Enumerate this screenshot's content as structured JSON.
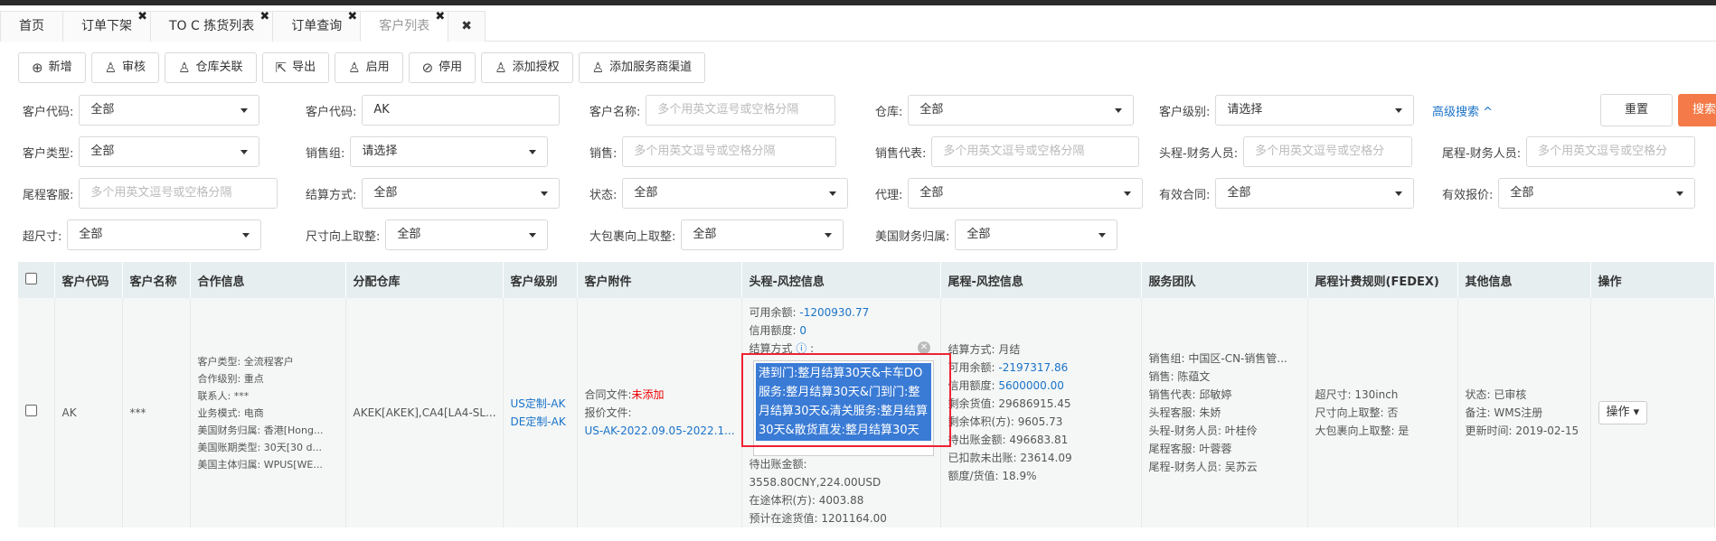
{
  "tabs": [
    {
      "label": "首页",
      "closable": false,
      "active": false
    },
    {
      "label": "订单下架",
      "closable": true,
      "active": false
    },
    {
      "label": "TO C 拣货列表",
      "closable": true,
      "active": false
    },
    {
      "label": "订单查询",
      "closable": true,
      "active": false
    },
    {
      "label": "客户列表",
      "closable": true,
      "active": true
    }
  ],
  "close_all_label": "✖",
  "toolbar": {
    "add": "新增",
    "review": "审核",
    "warehouse_link": "仓库关联",
    "export": "导出",
    "enable": "启用",
    "disable": "停用",
    "add_auth": "添加授权",
    "add_channel": "添加服务商渠道"
  },
  "filters": {
    "customer_code_1": {
      "label": "客户代码:",
      "value": "全部"
    },
    "customer_code_2": {
      "label": "客户代码:",
      "value": "AK"
    },
    "customer_name": {
      "label": "客户名称:",
      "placeholder": "多个用英文逗号或空格分隔"
    },
    "warehouse": {
      "label": "仓库:",
      "value": "全部"
    },
    "customer_level": {
      "label": "客户级别:",
      "value": "请选择"
    },
    "advanced": "高级搜索 ^",
    "reset": "重置",
    "search": "搜索",
    "customer_type": {
      "label": "客户类型:",
      "value": "全部"
    },
    "sales_group": {
      "label": "销售组:",
      "value": "请选择"
    },
    "sales": {
      "label": "销售:",
      "placeholder": "多个用英文逗号或空格分隔"
    },
    "sales_rep": {
      "label": "销售代表:",
      "placeholder": "多个用英文逗号或空格分隔"
    },
    "head_finance": {
      "label": "头程-财务人员:",
      "placeholder": "多个用英文逗号或空格分"
    },
    "tail_finance": {
      "label": "尾程-财务人员:",
      "placeholder": "多个用英文逗号或空格分"
    },
    "tail_service": {
      "label": "尾程客服:",
      "placeholder": "多个用英文逗号或空格分隔"
    },
    "settlement": {
      "label": "结算方式:",
      "value": "全部"
    },
    "status": {
      "label": "状态:",
      "value": "全部"
    },
    "agent": {
      "label": "代理:",
      "value": "全部"
    },
    "valid_contract": {
      "label": "有效合同:",
      "value": "全部"
    },
    "valid_quote": {
      "label": "有效报价:",
      "value": "全部"
    },
    "oversize": {
      "label": "超尺寸:",
      "value": "全部"
    },
    "size_round": {
      "label": "尺寸向上取整:",
      "value": "全部"
    },
    "big_round": {
      "label": "大包裹向上取整:",
      "value": "全部"
    },
    "us_finance": {
      "label": "美国财务归属:",
      "value": "全部"
    }
  },
  "table": {
    "headers": [
      "客户代码",
      "客户名称",
      "合作信息",
      "分配仓库",
      "客户级别",
      "客户附件",
      "头程-风控信息",
      "尾程-风控信息",
      "服务团队",
      "尾程计费规则(FEDEX)",
      "其他信息",
      "操作"
    ],
    "row": {
      "code": "AK",
      "name": "***",
      "coop": [
        "客户类型: 全流程客户",
        "合作级别: 重点",
        "联系人: ***",
        "业务模式: 电商",
        "美国财务归属: 香港[Hong...",
        "美国账期类型: 30天[30 d...",
        "美国主体归属: WPUS[WE..."
      ],
      "warehouse": "AKEK[AKEK],CA4[LA4-SL...",
      "levels": [
        "US定制-AK",
        "DE定制-AK"
      ],
      "attach_contract_label": "合同文件:",
      "attach_contract_value": "未添加",
      "attach_quote_label": "报价文件:",
      "attach_quote_value": "US-AK-2022.09.05-2022.1...",
      "head": {
        "avail_label": "可用余额:",
        "avail_value": "-1200930.77",
        "credit_label": "信用额度:",
        "credit_value": "0",
        "settle_label": "结算方式",
        "popup": "港到门:整月结算30天&卡车DO服务:整月结算30天&门到门:整月结算30天&清关服务:整月结算30天&散货直发:整月结算30天",
        "bottom": [
          "待出账金额: 3558.80CNY,224.00USD",
          "在途体积(方): 4003.88",
          "预计在途货值: 1201164.00"
        ]
      },
      "tail": {
        "settle": "结算方式: 月结",
        "avail_label": "可用余额:",
        "avail_value": "-2197317.86",
        "credit_label": "信用额度:",
        "credit_value": "5600000.00",
        "rest": [
          "剩余货值: 29686915.45",
          "剩余体积(方): 9605.73",
          "待出账金额: 496683.81",
          "已扣款未出账: 23614.09",
          "额度/货值: 18.9%"
        ]
      },
      "team": [
        "销售组: 中国区-CN-销售管...",
        "销售: 陈蕴文",
        "销售代表: 邱敏婷",
        "头程客服: 朱娇",
        "头程-财务人员: 叶桂伶",
        "尾程客服: 叶蓉蓉",
        "尾程-财务人员: 吴苏云"
      ],
      "fedex": [
        "超尺寸: 130inch",
        "尺寸向上取整: 否",
        "大包裹向上取整: 是"
      ],
      "other": [
        "状态: 已审核",
        "备注: WMS注册",
        "更新时间: 2019-02-15"
      ],
      "op": "操作 ▾"
    }
  }
}
